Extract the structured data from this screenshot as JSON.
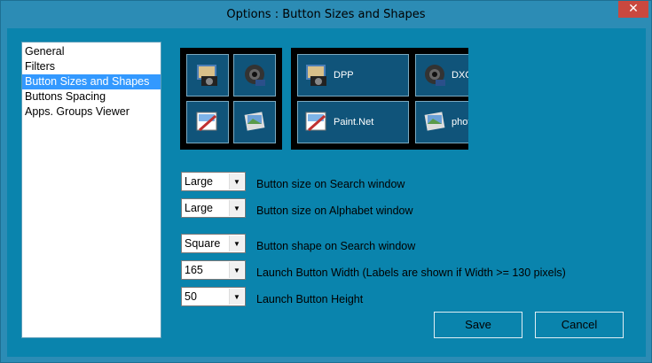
{
  "window": {
    "title": "Options : Button Sizes and Shapes",
    "close_label": "✕"
  },
  "nav": {
    "items": [
      {
        "label": "General",
        "selected": false
      },
      {
        "label": "Filters",
        "selected": false
      },
      {
        "label": "Button Sizes and Shapes",
        "selected": true
      },
      {
        "label": "Buttons Spacing",
        "selected": false
      },
      {
        "label": "Apps. Groups Viewer",
        "selected": false
      }
    ]
  },
  "preview": {
    "small_tiles": [
      {
        "icon": "camera-app-icon"
      },
      {
        "icon": "lens-app-icon"
      },
      {
        "icon": "paint-app-icon"
      },
      {
        "icon": "photo-app-icon"
      }
    ],
    "large_tiles": [
      {
        "icon": "camera-app-icon",
        "label": "DPP"
      },
      {
        "icon": "lens-app-icon",
        "label": "DXO"
      },
      {
        "icon": "paint-app-icon",
        "label": "Paint.Net"
      },
      {
        "icon": "photo-app-icon",
        "label": "phot"
      }
    ]
  },
  "settings": {
    "search_size": {
      "value": "Large",
      "label": "Button size on Search window"
    },
    "alphabet_size": {
      "value": "Large",
      "label": "Button size on Alphabet window"
    },
    "search_shape": {
      "value": "Square",
      "label": "Button shape on Search window"
    },
    "launch_width": {
      "value": "165",
      "label": "Launch Button Width (Labels are shown if Width >= 130 pixels)"
    },
    "launch_height": {
      "value": "50",
      "label": "Launch Button Height"
    }
  },
  "buttons": {
    "save": "Save",
    "cancel": "Cancel"
  },
  "colors": {
    "accent": "#0a84ad",
    "selection": "#3399ff",
    "close": "#c9483f"
  }
}
